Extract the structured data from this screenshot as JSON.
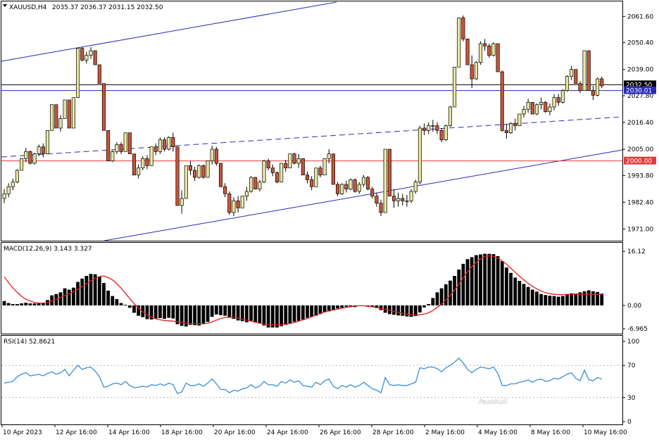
{
  "header": {
    "symbol": "XAUUSD,H4",
    "ohlc": "2035.37 2036.37 2031.15 2032.50"
  },
  "colors": {
    "bull": "#e8e6a0",
    "bear": "#c8553a",
    "wick": "#000000",
    "channel": "#2a2ab8",
    "support_line": "#e23a3a",
    "current_price_line": "#000000",
    "macd_hist": "#000000",
    "macd_signal": "#e02020",
    "rsi": "#3a8fd8",
    "watermark": "#eeeeee"
  },
  "chart_data": [
    {
      "type": "candlestick",
      "title": "XAUUSD,H4",
      "ylim": [
        1966,
        2068
      ],
      "y_ticks": [
        "2061.60",
        "2050.40",
        "2039.00",
        "2027.80",
        "2016.40",
        "2005.00",
        "1993.80",
        "1982.40",
        "1971.00"
      ],
      "price_labels": {
        "current": "2032.50",
        "bid_line": "2030.01",
        "support": "2000.00"
      },
      "support_level": 2000.0,
      "current_level": 2032.5,
      "bid_level": 2030.01,
      "x_labels": [
        "10 Apr 2023",
        "12 Apr 16:00",
        "14 Apr 16:00",
        "18 Apr 16:00",
        "20 Apr 16:00",
        "24 Apr 16:00",
        "26 Apr 16:00",
        "28 Apr 16:00",
        "2 May 16:00",
        "4 May 16:00",
        "8 May 16:00",
        "10 May 16:00"
      ],
      "close": [
        1986,
        1989,
        1991,
        1996,
        2001,
        2004,
        1999,
        2003,
        2006,
        2003,
        2013,
        2024,
        2014,
        2018,
        2026,
        2014,
        2027,
        2048,
        2043,
        2045,
        2047,
        2041,
        2033,
        2013,
        2000,
        2004,
        2007,
        2004,
        2012,
        2003,
        1994,
        1997,
        2001,
        1998,
        2006,
        2004,
        2009,
        2005,
        2010,
        2006,
        1981,
        1984,
        1998,
        1996,
        1993,
        1998,
        1993,
        2000,
        2005,
        1999,
        1989,
        1986,
        1978,
        1983,
        1980,
        1985,
        1987,
        1993,
        1988,
        1991,
        2000,
        1997,
        1995,
        1991,
        1999,
        1997,
        2003,
        1999,
        2001,
        1994,
        1992,
        1989,
        1997,
        1994,
        2001,
        2003,
        1990,
        1986,
        1990,
        1988,
        1992,
        1987,
        1990,
        1993,
        1988,
        1985,
        1982,
        1978,
        2005,
        1985,
        1983,
        1984,
        1983,
        1983,
        1987,
        1991,
        2014,
        2013,
        2015,
        2015,
        2013,
        2009,
        2015,
        2023,
        2040,
        2061,
        2052,
        2041,
        2035,
        2042,
        2050,
        2049,
        2045,
        2050,
        2038,
        2013,
        2012,
        2016,
        2015,
        2020,
        2022,
        2025,
        2020,
        2024,
        2025,
        2021,
        2023,
        2027,
        2025,
        2030,
        2036,
        2039,
        2033,
        2030,
        2047,
        2030,
        2028,
        2035,
        2032
      ],
      "range": [
        6,
        6,
        5,
        6,
        5,
        6,
        6,
        5,
        5,
        6,
        7,
        8,
        9,
        7,
        8,
        8,
        10,
        10,
        6,
        5,
        5,
        6,
        8,
        9,
        10,
        5,
        5,
        5,
        7,
        8,
        8,
        6,
        6,
        6,
        6,
        5,
        7,
        6,
        6,
        8,
        17,
        10,
        8,
        6,
        6,
        6,
        6,
        6,
        8,
        8,
        9,
        6,
        10,
        8,
        7,
        5,
        6,
        7,
        5,
        5,
        10,
        5,
        5,
        5,
        6,
        5,
        6,
        5,
        6,
        5,
        5,
        6,
        7,
        5,
        7,
        6,
        11,
        6,
        5,
        5,
        5,
        6,
        5,
        5,
        6,
        5,
        6,
        7,
        27,
        9,
        8,
        6,
        5,
        5,
        6,
        6,
        25,
        5,
        5,
        5,
        5,
        6,
        7,
        9,
        17,
        20,
        11,
        11,
        14,
        8,
        10,
        5,
        6,
        6,
        12,
        26,
        6,
        5,
        5,
        5,
        5,
        6,
        5,
        5,
        5,
        5,
        5,
        7,
        5,
        6,
        7,
        6,
        6,
        5,
        17,
        11,
        6,
        8,
        5
      ]
    },
    {
      "type": "bar",
      "title": "MACD(12,26,9) 3.143 3.327",
      "ylim": [
        -8,
        17
      ],
      "y_ticks": [
        "16.12",
        "0.00",
        "-6.965"
      ],
      "y_tick_values": [
        16.12,
        0,
        -6.965
      ],
      "series": [
        {
          "name": "MACD",
          "kind": "histogram",
          "values": [
            1.3,
            0.7,
            0.4,
            0.4,
            0.6,
            0.8,
            0.6,
            0.6,
            0.6,
            0.8,
            1.6,
            3.0,
            3.4,
            3.9,
            5.1,
            4.7,
            5.3,
            7.0,
            8.0,
            8.8,
            9.4,
            9.3,
            8.6,
            6.7,
            4.4,
            2.8,
            1.9,
            0.7,
            0.2,
            -0.7,
            -2.2,
            -3.1,
            -3.5,
            -4.1,
            -4.2,
            -3.9,
            -3.8,
            -4.0,
            -3.7,
            -3.9,
            -5.6,
            -6.1,
            -6.3,
            -5.8,
            -5.9,
            -6.0,
            -5.5,
            -4.9,
            -3.4,
            -2.7,
            -2.9,
            -3.1,
            -3.7,
            -4.0,
            -4.5,
            -4.7,
            -5.0,
            -4.6,
            -5.1,
            -5.4,
            -6.0,
            -6.6,
            -6.6,
            -6.6,
            -6.2,
            -5.8,
            -5.4,
            -4.9,
            -4.6,
            -4.2,
            -3.7,
            -3.4,
            -3.1,
            -2.6,
            -2.0,
            -1.8,
            -1.5,
            -0.9,
            -0.8,
            -0.4,
            -0.3,
            -0.5,
            -0.2,
            0.0,
            0.0,
            -0.5,
            -0.8,
            -1.4,
            -2.2,
            -2.6,
            -2.8,
            -3.0,
            -3.1,
            -3.3,
            -3.4,
            -3.2,
            -2.1,
            -0.6,
            0.4,
            2.2,
            3.9,
            5.1,
            6.3,
            7.4,
            8.8,
            10.7,
            12.4,
            13.8,
            14.4,
            15.0,
            15.2,
            15.4,
            15.4,
            15.3,
            14.7,
            13.2,
            11.3,
            9.7,
            8.3,
            7.3,
            6.4,
            5.5,
            4.7,
            4.1,
            3.4,
            3.1,
            2.9,
            2.8,
            2.6,
            2.8,
            3.2,
            3.6,
            3.5,
            3.9,
            4.2,
            4.5,
            4.2,
            4.0,
            3.5
          ]
        },
        {
          "name": "Signal",
          "kind": "line",
          "values": [
            8.5,
            6.8,
            5.2,
            3.9,
            2.7,
            1.8,
            1.3,
            0.9,
            0.7,
            0.7,
            0.9,
            1.3,
            1.8,
            2.4,
            3.0,
            3.5,
            4.1,
            4.8,
            5.6,
            6.5,
            7.3,
            8.1,
            8.6,
            8.8,
            8.3,
            7.6,
            6.5,
            5.1,
            3.6,
            2.0,
            0.5,
            -0.8,
            -1.9,
            -2.8,
            -3.5,
            -4.0,
            -4.3,
            -4.5,
            -4.6,
            -4.7,
            -4.9,
            -5.1,
            -5.3,
            -5.4,
            -5.4,
            -5.5,
            -5.5,
            -5.3,
            -4.9,
            -4.4,
            -3.9,
            -3.6,
            -3.5,
            -3.6,
            -3.8,
            -4.1,
            -4.4,
            -4.7,
            -5.0,
            -5.3,
            -5.6,
            -5.8,
            -5.8,
            -5.8,
            -5.8,
            -5.6,
            -5.4,
            -5.1,
            -4.7,
            -4.3,
            -3.9,
            -3.4,
            -2.9,
            -2.4,
            -2.0,
            -1.6,
            -1.3,
            -1.1,
            -0.8,
            -0.6,
            -0.4,
            -0.2,
            -0.1,
            -0.1,
            -0.3,
            -0.4,
            -0.6,
            -0.9,
            -1.2,
            -1.5,
            -1.8,
            -2.1,
            -2.4,
            -2.6,
            -2.8,
            -2.9,
            -2.8,
            -2.6,
            -2.2,
            -1.5,
            -0.6,
            0.4,
            1.6,
            3.0,
            4.6,
            6.3,
            8.2,
            10.0,
            11.6,
            12.9,
            13.9,
            14.6,
            14.8,
            14.6,
            14.1,
            13.3,
            12.3,
            11.1,
            9.9,
            8.7,
            7.6,
            6.6,
            5.7,
            4.9,
            4.3,
            3.8,
            3.5,
            3.3,
            3.2,
            3.2,
            3.3,
            3.3,
            3.4,
            3.4,
            3.3,
            3.3,
            3.3,
            3.3,
            3.3
          ]
        }
      ]
    },
    {
      "type": "line",
      "title": "RSI(14) 52.8621",
      "ylim": [
        0,
        100
      ],
      "y_ticks": [
        "100",
        "70",
        "30",
        "0"
      ],
      "y_tick_values": [
        100,
        70,
        30,
        0
      ],
      "levels": [
        70,
        30
      ],
      "series": [
        {
          "name": "RSI",
          "values": [
            48,
            49,
            50,
            56,
            59,
            61,
            57,
            58,
            59,
            57,
            60,
            62,
            59,
            61,
            65,
            57,
            64,
            70,
            65,
            67,
            68,
            63,
            56,
            43,
            44,
            47,
            48,
            46,
            50,
            45,
            42,
            43,
            44,
            43,
            46,
            45,
            47,
            45,
            48,
            46,
            35,
            37,
            48,
            45,
            45,
            47,
            44,
            48,
            53,
            47,
            40,
            40,
            36,
            39,
            38,
            41,
            42,
            46,
            42,
            44,
            50,
            46,
            46,
            44,
            50,
            48,
            52,
            49,
            51,
            45,
            44,
            43,
            49,
            46,
            51,
            53,
            44,
            41,
            45,
            43,
            46,
            43,
            45,
            49,
            45,
            41,
            39,
            36,
            55,
            46,
            45,
            46,
            45,
            45,
            47,
            49,
            67,
            66,
            68,
            68,
            66,
            62,
            67,
            70,
            74,
            79,
            73,
            65,
            61,
            65,
            68,
            67,
            66,
            68,
            60,
            45,
            45,
            47,
            47,
            49,
            50,
            52,
            49,
            52,
            53,
            50,
            51,
            54,
            53,
            56,
            59,
            61,
            54,
            51,
            64,
            52,
            51,
            55,
            53
          ]
        }
      ]
    }
  ],
  "watermark_text": "FastBull"
}
